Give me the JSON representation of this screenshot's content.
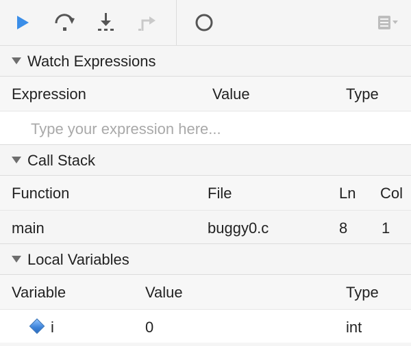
{
  "toolbar": {
    "buttons": [
      {
        "icon": "continue-icon",
        "color": "#3b8ee8"
      },
      {
        "icon": "step-over-icon"
      },
      {
        "icon": "step-into-icon"
      },
      {
        "icon": "step-out-icon"
      },
      {
        "icon": "record-icon"
      },
      {
        "icon": "menu-icon"
      }
    ]
  },
  "watch": {
    "title": "Watch Expressions",
    "columns": [
      "Expression",
      "Value",
      "Type"
    ],
    "input_placeholder": "Type your expression here..."
  },
  "callstack": {
    "title": "Call Stack",
    "columns": [
      "Function",
      "File",
      "Ln",
      "Col"
    ],
    "rows": [
      {
        "function": "main",
        "file": "buggy0.c",
        "ln": "8",
        "col": "1"
      }
    ]
  },
  "locals": {
    "title": "Local Variables",
    "columns": [
      "Variable",
      "Value",
      "Type"
    ],
    "rows": [
      {
        "variable": "i",
        "value": "0",
        "type": "int"
      }
    ]
  }
}
